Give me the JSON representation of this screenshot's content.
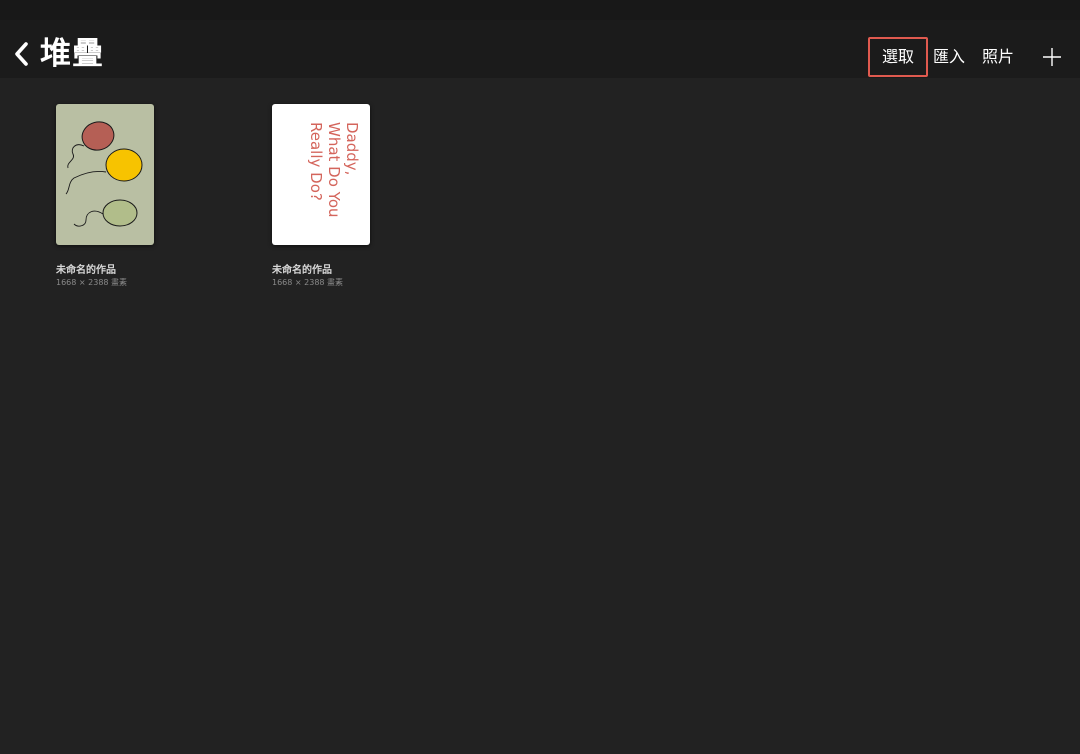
{
  "header": {
    "title": "堆疊",
    "back_icon": "chevron-left-icon"
  },
  "toolbar": {
    "select_label": "選取",
    "import_label": "匯入",
    "photo_label": "照片",
    "add_icon": "plus-icon",
    "highlight_color": "#e05a4f"
  },
  "artworks": [
    {
      "title": "未命名的作品",
      "size": "1668 × 2388 畫素",
      "thumbnail": "balloons-drawing",
      "background": "#b9bfa3"
    },
    {
      "title": "未命名的作品",
      "size": "1668 × 2388 畫素",
      "thumbnail": "handwritten-note",
      "background": "#ffffff",
      "handwriting": [
        "Daddy,",
        "What Do You",
        "Really Do?"
      ]
    }
  ]
}
